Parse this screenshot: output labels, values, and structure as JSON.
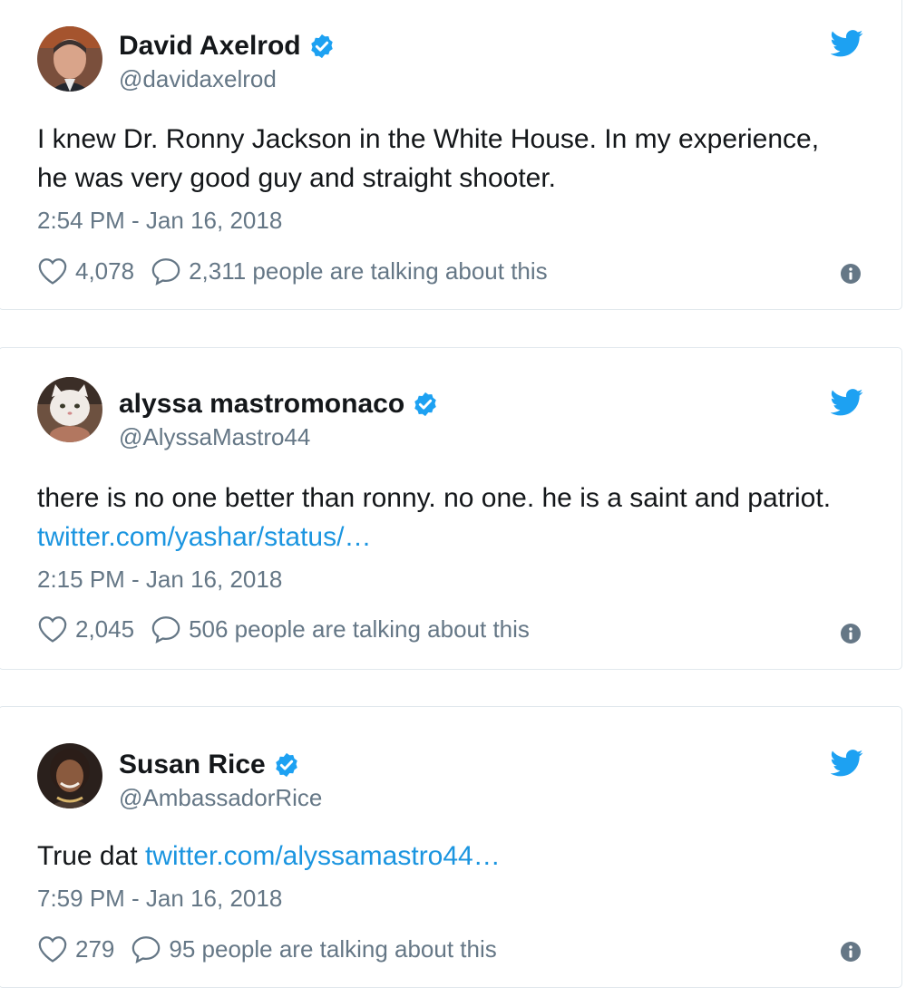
{
  "tweets": [
    {
      "name": "David Axelrod",
      "handle": "@davidaxelrod",
      "text_plain": "I knew Dr. Ronny Jackson in the White House.  In my experience, he was very good guy and straight shooter.",
      "text_link": "",
      "time": "2:54 PM - Jan 16, 2018",
      "likes": "4,078",
      "talking": "2,311 people are talking about this"
    },
    {
      "name": "alyssa mastromonaco",
      "handle": "@AlyssaMastro44",
      "text_plain": "there is no one better than ronny. no one. he is a saint and patriot. ",
      "text_link": "twitter.com/yashar/status/…",
      "time": "2:15 PM - Jan 16, 2018",
      "likes": "2,045",
      "talking": "506 people are talking about this"
    },
    {
      "name": "Susan Rice",
      "handle": "@AmbassadorRice",
      "text_plain": "True dat ",
      "text_link": "twitter.com/alyssamastro44…",
      "time": "7:59 PM - Jan 16, 2018",
      "likes": "279",
      "talking": "95 people are talking about this"
    }
  ],
  "icons": {
    "verified": "verified-badge-icon",
    "twitter": "twitter-bird-icon",
    "like": "heart-icon",
    "reply": "speech-bubble-icon",
    "info": "info-icon"
  },
  "colors": {
    "accent": "#1da1f2",
    "link": "#1b95e0",
    "muted": "#657786",
    "border": "#e1e8ed"
  }
}
